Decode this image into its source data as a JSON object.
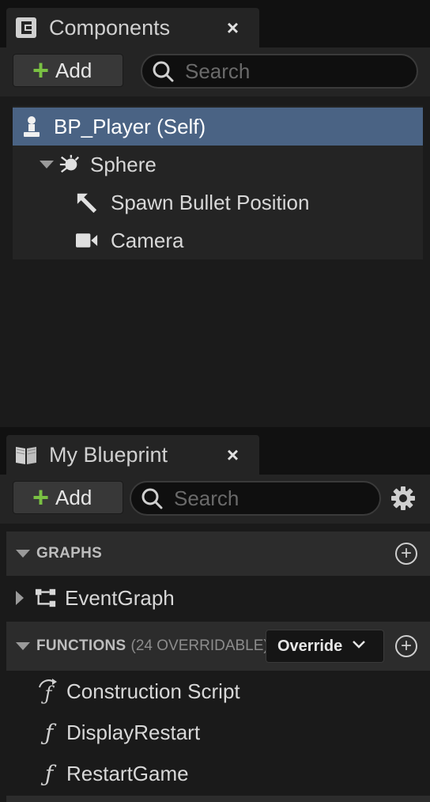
{
  "components": {
    "tab_title": "Components",
    "close_label": "×",
    "add_label": "Add",
    "search_placeholder": "Search",
    "tree": [
      {
        "label": "BP_Player (Self)",
        "icon": "pawn-icon",
        "selected": true
      },
      {
        "label": "Sphere",
        "icon": "sphere-icon",
        "expanded": true
      },
      {
        "label": "Spawn Bullet Position",
        "icon": "arrow-component-icon"
      },
      {
        "label": "Camera",
        "icon": "camera-icon"
      }
    ]
  },
  "my_blueprint": {
    "tab_title": "My Blueprint",
    "close_label": "×",
    "add_label": "Add",
    "search_placeholder": "Search",
    "graphs": {
      "title": "GRAPHS",
      "items": [
        {
          "label": "EventGraph"
        }
      ]
    },
    "functions": {
      "title": "FUNCTIONS",
      "subtitle": "(24 OVERRIDABLE)",
      "override_label": "Override",
      "items": [
        {
          "label": "Construction Script"
        },
        {
          "label": "DisplayRestart"
        },
        {
          "label": "RestartGame"
        }
      ]
    }
  },
  "colors": {
    "selection": "#4a6384",
    "add_plus": "#7ac143",
    "panel_bg": "#242424"
  }
}
